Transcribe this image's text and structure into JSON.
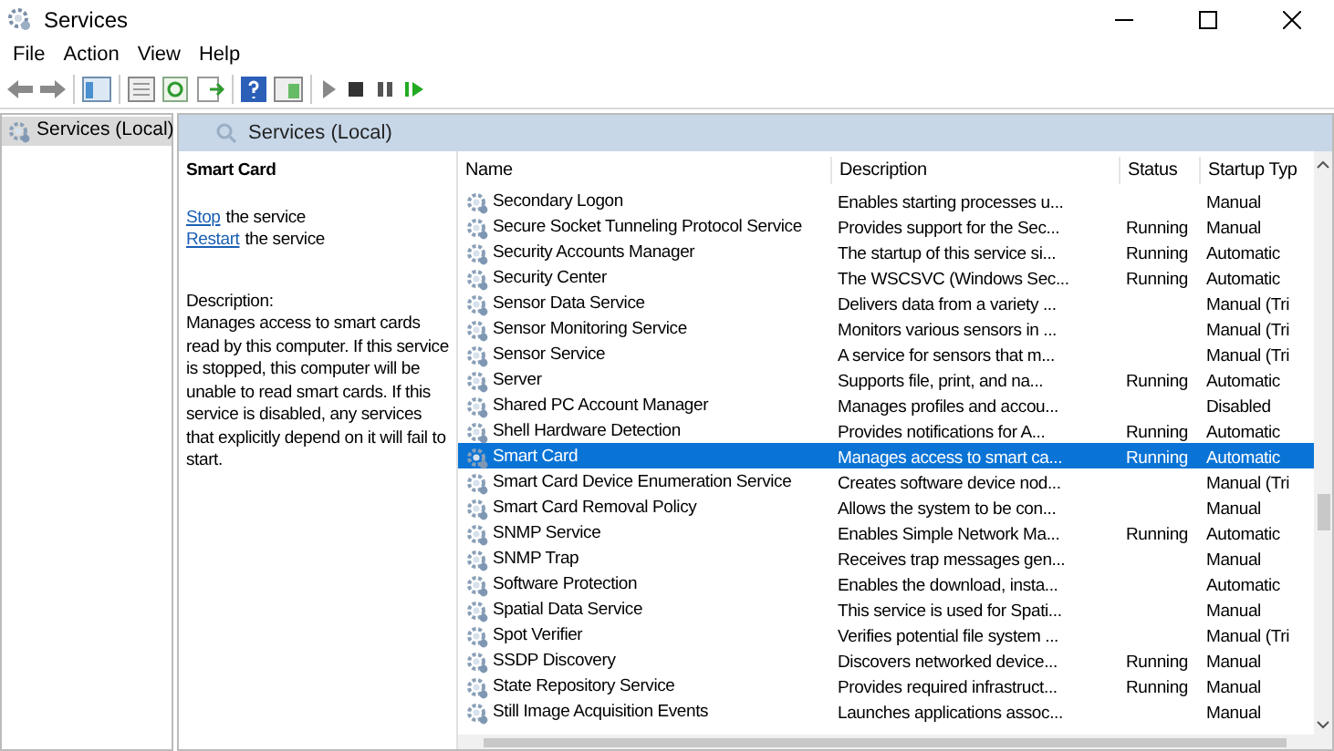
{
  "window": {
    "title": "Services"
  },
  "menu": [
    "File",
    "Action",
    "View",
    "Help"
  ],
  "tree": [
    {
      "label": "Services (Local)",
      "selected": true
    }
  ],
  "pane_header": "Services (Local)",
  "details": {
    "title": "Smart Card",
    "actions": [
      {
        "link": "Stop",
        "text": "the service"
      },
      {
        "link": "Restart",
        "text": "the service"
      }
    ],
    "description_label": "Description:",
    "description": "Manages access to smart cards read by this computer. If this service is stopped, this computer will be unable to read smart cards. If this service is disabled, any services that explicitly depend on it will fail to start."
  },
  "table": {
    "columns": [
      "Name",
      "Description",
      "Status",
      "Startup Typ"
    ],
    "rows": [
      {
        "name": "Secondary Logon",
        "description": "Enables starting processes u...",
        "status": "",
        "startup": "Manual",
        "selected": false
      },
      {
        "name": "Secure Socket Tunneling Protocol Service",
        "description": "Provides support for the Sec...",
        "status": "Running",
        "startup": "Manual",
        "selected": false
      },
      {
        "name": "Security Accounts Manager",
        "description": "The startup of this service si...",
        "status": "Running",
        "startup": "Automatic",
        "selected": false
      },
      {
        "name": "Security Center",
        "description": "The WSCSVC (Windows Sec...",
        "status": "Running",
        "startup": "Automatic",
        "selected": false
      },
      {
        "name": "Sensor Data Service",
        "description": "Delivers data from a variety ...",
        "status": "",
        "startup": "Manual (Tri",
        "selected": false
      },
      {
        "name": "Sensor Monitoring Service",
        "description": "Monitors various sensors in ...",
        "status": "",
        "startup": "Manual (Tri",
        "selected": false
      },
      {
        "name": "Sensor Service",
        "description": "A service for sensors that m...",
        "status": "",
        "startup": "Manual (Tri",
        "selected": false
      },
      {
        "name": "Server",
        "description": "Supports file, print, and na...",
        "status": "Running",
        "startup": "Automatic",
        "selected": false
      },
      {
        "name": "Shared PC Account Manager",
        "description": "Manages profiles and accou...",
        "status": "",
        "startup": "Disabled",
        "selected": false
      },
      {
        "name": "Shell Hardware Detection",
        "description": "Provides notifications for A...",
        "status": "Running",
        "startup": "Automatic",
        "selected": false
      },
      {
        "name": "Smart Card",
        "description": "Manages access to smart ca...",
        "status": "Running",
        "startup": "Automatic",
        "selected": true
      },
      {
        "name": "Smart Card Device Enumeration Service",
        "description": "Creates software device nod...",
        "status": "",
        "startup": "Manual (Tri",
        "selected": false
      },
      {
        "name": "Smart Card Removal Policy",
        "description": "Allows the system to be con...",
        "status": "",
        "startup": "Manual",
        "selected": false
      },
      {
        "name": "SNMP Service",
        "description": "Enables Simple Network Ma...",
        "status": "Running",
        "startup": "Automatic",
        "selected": false
      },
      {
        "name": "SNMP Trap",
        "description": "Receives trap messages gen...",
        "status": "",
        "startup": "Manual",
        "selected": false
      },
      {
        "name": "Software Protection",
        "description": "Enables the download, insta...",
        "status": "",
        "startup": "Automatic",
        "selected": false
      },
      {
        "name": "Spatial Data Service",
        "description": "This service is used for Spati...",
        "status": "",
        "startup": "Manual",
        "selected": false
      },
      {
        "name": "Spot Verifier",
        "description": "Verifies potential file system ...",
        "status": "",
        "startup": "Manual (Tri",
        "selected": false
      },
      {
        "name": "SSDP Discovery",
        "description": "Discovers networked device...",
        "status": "Running",
        "startup": "Manual",
        "selected": false
      },
      {
        "name": "State Repository Service",
        "description": "Provides required infrastruct...",
        "status": "Running",
        "startup": "Manual",
        "selected": false
      },
      {
        "name": "Still Image Acquisition Events",
        "description": "Launches applications assoc...",
        "status": "",
        "startup": "Manual",
        "selected": false
      }
    ]
  }
}
